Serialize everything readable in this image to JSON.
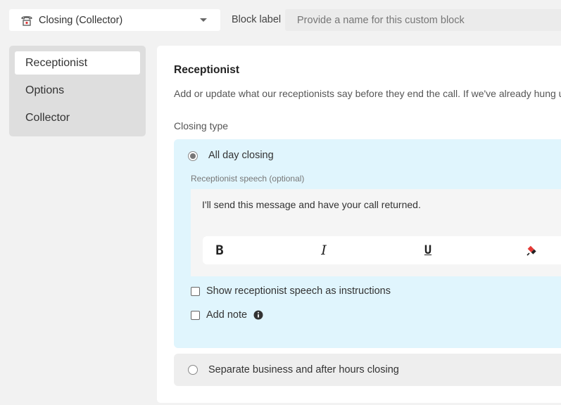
{
  "header": {
    "block_select_value": "Closing (Collector)",
    "block_label": "Block label",
    "block_label_placeholder": "Provide a name for this custom block"
  },
  "sidebar": {
    "items": [
      {
        "label": "Receptionist",
        "active": true
      },
      {
        "label": "Options",
        "active": false
      },
      {
        "label": "Collector",
        "active": false
      }
    ]
  },
  "main": {
    "title": "Receptionist",
    "description": "Add or update what our receptionists say before they end the call. If we've already hung u",
    "closing_type_label": "Closing type",
    "options": [
      {
        "label": "All day closing",
        "selected": true
      },
      {
        "label": "Separate business and after hours closing",
        "selected": false
      }
    ],
    "speech_label": "Receptionist speech (optional)",
    "speech_text": "I'll send this message and have your call returned.",
    "toolbar": [
      "bold-icon",
      "italic-icon",
      "underline-icon",
      "eraser-icon"
    ],
    "show_as_instructions_label": "Show receptionist speech as instructions",
    "add_note_label": "Add note"
  },
  "colors": {
    "selected_card_bg": "#e0f5fd",
    "eraser_accent": "#e53935"
  }
}
